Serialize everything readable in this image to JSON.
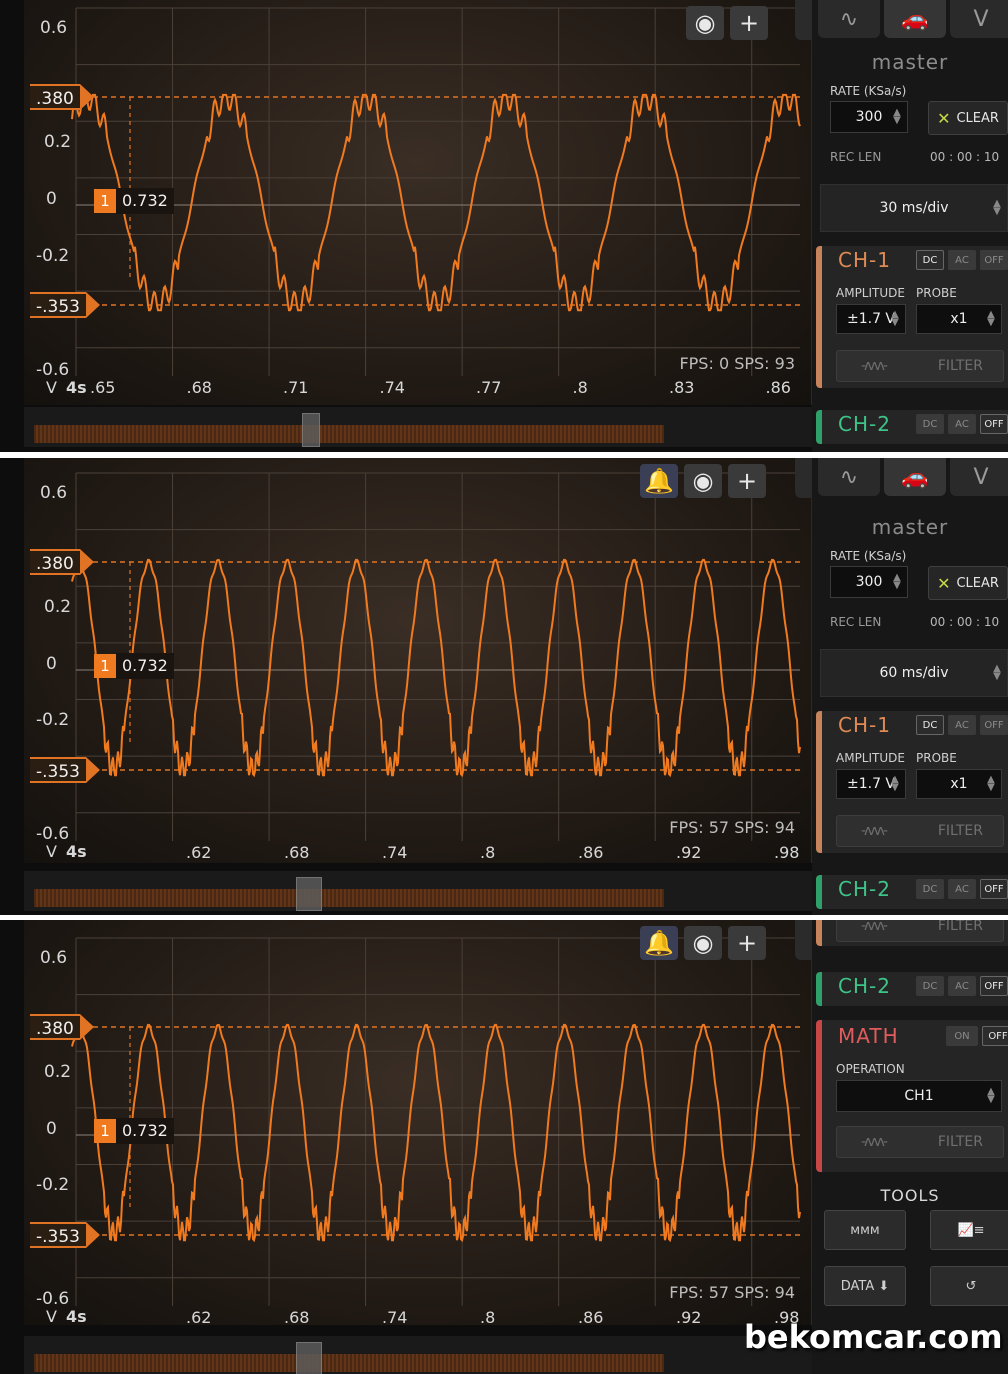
{
  "panels": [
    {
      "y_ticks": [
        "0.6",
        "0.2",
        "0",
        "-0.2",
        "-0.6"
      ],
      "hi_marker": ".380",
      "lo_marker": "-.353",
      "cursor_num": "1",
      "cursor_val": "0.732",
      "x_prefix": "V",
      "x_unit": "4s",
      "x_ticks": [
        ".65",
        ".68",
        ".71",
        ".74",
        ".77",
        ".8",
        ".83",
        ".86"
      ],
      "fps_text": "FPS: 0  SPS: 93",
      "show_bell": false,
      "cycles": 5.2,
      "timebase": "30 ms/div"
    },
    {
      "y_ticks": [
        "0.6",
        "0.2",
        "0",
        "-0.2",
        "-0.6"
      ],
      "hi_marker": ".380",
      "lo_marker": "-.353",
      "cursor_num": "1",
      "cursor_val": "0.732",
      "x_prefix": "V",
      "x_unit": "4s",
      "x_ticks": [
        ".62",
        ".68",
        ".74",
        ".8",
        ".86",
        ".92",
        ".98"
      ],
      "fps_text": "FPS: 57  SPS: 94",
      "show_bell": true,
      "cycles": 10.5,
      "timebase": "60 ms/div"
    },
    {
      "y_ticks": [
        "0.6",
        "0.2",
        "0",
        "-0.2",
        "-0.6"
      ],
      "hi_marker": ".380",
      "lo_marker": "-.353",
      "cursor_num": "1",
      "cursor_val": "0.732",
      "x_prefix": "V",
      "x_unit": "4s",
      "x_ticks": [
        ".62",
        ".68",
        ".74",
        ".8",
        ".86",
        ".92",
        ".98"
      ],
      "fps_text": "FPS: 57  SPS: 94",
      "show_bell": true,
      "cycles": 10.5
    }
  ],
  "sidebar": {
    "master": "master",
    "rate_label": "RATE (KSa/s)",
    "rate_value": "300",
    "clear_label": "CLEAR",
    "reclen_label": "REC LEN",
    "reclen_value": "00 : 00 : 10",
    "ch1": "CH-1",
    "ch2": "CH-2",
    "modes": [
      "DC",
      "AC",
      "OFF"
    ],
    "amplitude_label": "AMPLITUDE",
    "probe_label": "PROBE",
    "amplitude_value": "±1.7 V",
    "probe_value": "x1",
    "filter_label": "FILTER",
    "math": "MATH",
    "math_on": "ON",
    "math_off": "OFF",
    "operation_label": "OPERATION",
    "operation_value": "CH1",
    "tools": "TOOLS",
    "data_label": "DATA"
  },
  "watermark": "bekomcar.com",
  "colors": {
    "trace": "#f07a20",
    "ch1": "#e08a54",
    "ch2": "#3ec488",
    "math": "#e15c5c"
  }
}
